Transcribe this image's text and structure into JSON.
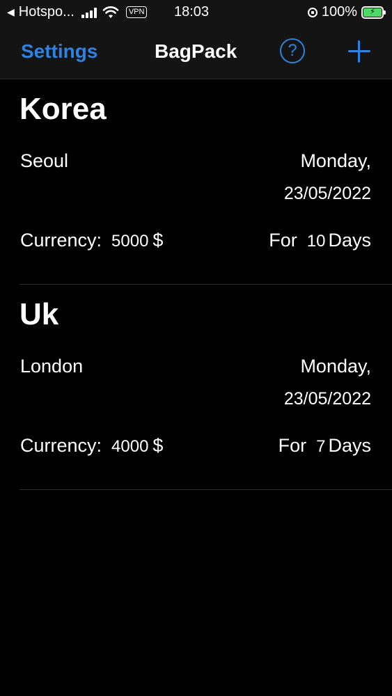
{
  "status_bar": {
    "back_glyph": "◀",
    "carrier": "Hotspo...",
    "vpn": "VPN",
    "time": "18:03",
    "battery_percent": "100%",
    "battery_color": "#4cd964"
  },
  "nav": {
    "back_label": "Settings",
    "title": "BagPack",
    "help_icon": "?",
    "add_icon": "plus-icon",
    "accent_color": "#2f83e0"
  },
  "trips": [
    {
      "country": "Korea",
      "city": "Seoul",
      "day": "Monday,",
      "date": "23/05/2022",
      "currency_label": "Currency:",
      "amount": "5000",
      "symbol": "$",
      "for_label": "For",
      "days": "10",
      "days_label": "Days"
    },
    {
      "country": "Uk",
      "city": "London",
      "day": "Monday,",
      "date": "23/05/2022",
      "currency_label": "Currency:",
      "amount": "4000",
      "symbol": "$",
      "for_label": "For",
      "days": "7",
      "days_label": "Days"
    }
  ]
}
